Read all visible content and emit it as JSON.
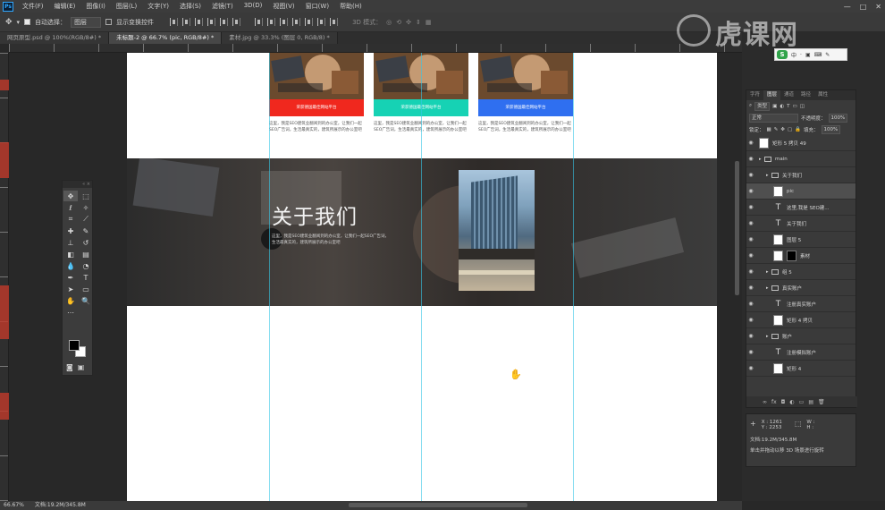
{
  "app": {
    "logo": "Ps"
  },
  "menu": [
    "文件(F)",
    "编辑(E)",
    "图像(I)",
    "图层(L)",
    "文字(Y)",
    "选择(S)",
    "滤镜(T)",
    "3D(D)",
    "视图(V)",
    "窗口(W)",
    "帮助(H)"
  ],
  "window_controls": {
    "minimize": "—",
    "maximize": "□",
    "close": "✕"
  },
  "options": {
    "auto_select_label": "自动选择：",
    "auto_select_value": "图层",
    "show_transform_label": "显示变换控件",
    "mode_3d_label": "3D 模式："
  },
  "tabs": [
    {
      "label": "网页原型.psd @ 100%(RGB/8#) *",
      "active": false
    },
    {
      "label": "未标题-2 @ 66.7% (pic, RGB/8#) *",
      "active": true
    },
    {
      "label": "素材.jpg @ 33.3% (图层 0, RGB/8) *",
      "active": false
    }
  ],
  "doc": {
    "cards": [
      {
        "band_text": "荣获德国最佳网站平台",
        "color": "#f0281e",
        "desc": "这里，我是SEO建筑业翻阅到的办公室，让我们一起SEO广告词，生活最真实的，建筑所展示的办公室吧"
      },
      {
        "band_text": "荣获德国最佳网站平台",
        "color": "#16d2b4",
        "desc": "这里，我是SEO建筑业翻阅到的办公室，让我们一起SEO广告词，生活最真实的，建筑所展示的办公室吧"
      },
      {
        "band_text": "荣获德国最佳网站平台",
        "color": "#2f6ff0",
        "desc": "这里，我是SEO建筑业翻阅到的办公室，让我们一起SEO广告词，生活最真实的，建筑所展示的办公室吧"
      }
    ],
    "about": {
      "title": "关于我们",
      "desc": "这里，我是SEO建筑业翻阅到的办公室，让我们一起SEO广告词，生活最真实的，建筑所展示的办公室吧"
    }
  },
  "watermark": {
    "text": "虎课网"
  },
  "sogou": {
    "letter": "S",
    "items": [
      "中",
      "·",
      "▣",
      "⌨",
      "✎"
    ]
  },
  "layers": {
    "tabs": [
      {
        "label": "字符",
        "active": false
      },
      {
        "label": "图层",
        "active": true
      },
      {
        "label": "通道",
        "active": false
      },
      {
        "label": "路径",
        "active": false
      },
      {
        "label": "属性",
        "active": false
      }
    ],
    "filter_kind": "类型",
    "blend_mode": "正常",
    "opacity_label": "不透明度：",
    "opacity_value": "100%",
    "lock_label": "锁定：",
    "fill_label": "填充：",
    "fill_value": "100%",
    "items": [
      {
        "name": "矩形 5 拷贝 49",
        "kind": "layer",
        "indent": 0,
        "selected": false
      },
      {
        "name": "main",
        "kind": "folder",
        "indent": 0,
        "selected": false
      },
      {
        "name": "关于我们",
        "kind": "folder",
        "indent": 1,
        "selected": false
      },
      {
        "name": "pic",
        "kind": "layer",
        "indent": 2,
        "selected": true
      },
      {
        "name": "这里,我是 SEO建...",
        "kind": "text",
        "indent": 2,
        "selected": false
      },
      {
        "name": "关于我们",
        "kind": "text",
        "indent": 2,
        "selected": false
      },
      {
        "name": "图层 5",
        "kind": "layer",
        "indent": 2,
        "selected": false
      },
      {
        "name": "素材",
        "kind": "mask",
        "indent": 2,
        "selected": false
      },
      {
        "name": "组 5",
        "kind": "folder",
        "indent": 1,
        "selected": false
      },
      {
        "name": "真实账户",
        "kind": "folder",
        "indent": 1,
        "selected": false
      },
      {
        "name": "注册真实账户",
        "kind": "text",
        "indent": 2,
        "selected": false
      },
      {
        "name": "矩形 4 拷贝",
        "kind": "layer",
        "indent": 2,
        "selected": false
      },
      {
        "name": "账户",
        "kind": "folder",
        "indent": 1,
        "selected": false
      },
      {
        "name": "注册模拟账户",
        "kind": "text",
        "indent": 2,
        "selected": false
      },
      {
        "name": "矩形 4",
        "kind": "layer",
        "indent": 2,
        "selected": false
      }
    ],
    "footer_icons": [
      "∞",
      "fx",
      "◘",
      "◐",
      "▭",
      "▤",
      "🗑"
    ]
  },
  "info": {
    "x_label": "X :",
    "x_value": "1261",
    "y_label": "Y :",
    "y_value": "2253",
    "w_label": "W :",
    "h_label": "H :",
    "doc_size": "文档:19.2M/345.8M",
    "hint": "单击并拖动以移 3D 场景进行旋转"
  },
  "status": {
    "zoom": "66.67%",
    "doc_size": "文档:19.2M/345.8M"
  }
}
